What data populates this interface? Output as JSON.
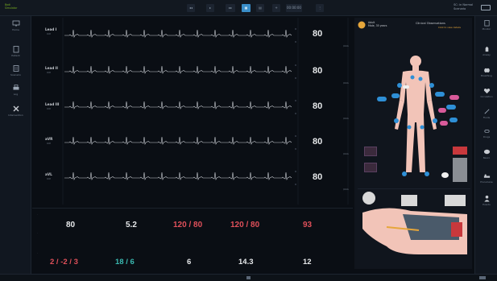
{
  "topbar": {
    "brand_line1": "Bodi",
    "brand_line2": "Simulator",
    "time_value": "00:00:00",
    "right_line1": "SC: in Normal",
    "right_line2": "Scenario"
  },
  "leftbar": {
    "items": [
      {
        "label": "Home",
        "icon": "monitor-icon"
      },
      {
        "label": "Patient",
        "icon": "clipboard-icon"
      },
      {
        "label": "Scenario",
        "icon": "document-icon"
      },
      {
        "label": "Log",
        "icon": "printer-icon"
      },
      {
        "label": "Intervention",
        "icon": "tools-icon"
      }
    ]
  },
  "rightbar": {
    "items": [
      {
        "label": "Monitor",
        "icon": "clipboard-icon"
      },
      {
        "label": "Airway",
        "icon": "hand-icon"
      },
      {
        "label": "Breathing",
        "icon": "lungs-icon"
      },
      {
        "label": "Circulation",
        "icon": "heart-icon"
      },
      {
        "label": "Fluids",
        "icon": "syringe-icon"
      },
      {
        "label": "Drugs",
        "icon": "pill-icon"
      },
      {
        "label": "Neuro",
        "icon": "brain-icon"
      },
      {
        "label": "Procedures",
        "icon": "bed-icon"
      },
      {
        "label": "Events",
        "icon": "doctor-icon"
      }
    ]
  },
  "ecg": {
    "leads": [
      {
        "label": "Lead I",
        "unit": "mV",
        "hr": "80",
        "hr_unit": "/min"
      },
      {
        "label": "Lead II",
        "unit": "mV",
        "hr": "80",
        "hr_unit": "/min"
      },
      {
        "label": "Lead III",
        "unit": "mV",
        "hr": "80",
        "hr_unit": "/min"
      },
      {
        "label": "aVR",
        "unit": "mV",
        "hr": "80",
        "hr_unit": "/min"
      },
      {
        "label": "aVL",
        "unit": "mV",
        "hr": "80",
        "hr_unit": "/min"
      }
    ]
  },
  "vitals": {
    "row1": [
      {
        "value": "80",
        "color": "#e6e8ea"
      },
      {
        "value": "5.2",
        "color": "#e6e8ea"
      },
      {
        "value": "120 / 80",
        "color": "#e0505a"
      },
      {
        "value": "120 / 80",
        "color": "#e0505a"
      },
      {
        "value": "93",
        "color": "#e0505a"
      }
    ],
    "row2": [
      {
        "value": "2 / -2 / 3",
        "color": "#e0505a"
      },
      {
        "value": "18 / 6",
        "color": "#3ab8b0"
      },
      {
        "value": "6",
        "color": "#e6e8ea"
      },
      {
        "value": "14.3",
        "color": "#e6e8ea"
      },
      {
        "value": "12",
        "color": "#e6e8ea"
      }
    ]
  },
  "panel": {
    "patient_line1": "Adult",
    "patient_line2": "Male, 35 years",
    "title": "Clinical Observations",
    "subtitle": "Click to view details"
  },
  "colors": {
    "accent": "#3a8ec8",
    "alarm": "#e0505a",
    "ecg_trace": "#c8ccd2",
    "skin": "#f2c4b8",
    "sensor": "#2e8fd6",
    "pink_tag": "#d85a9a"
  }
}
